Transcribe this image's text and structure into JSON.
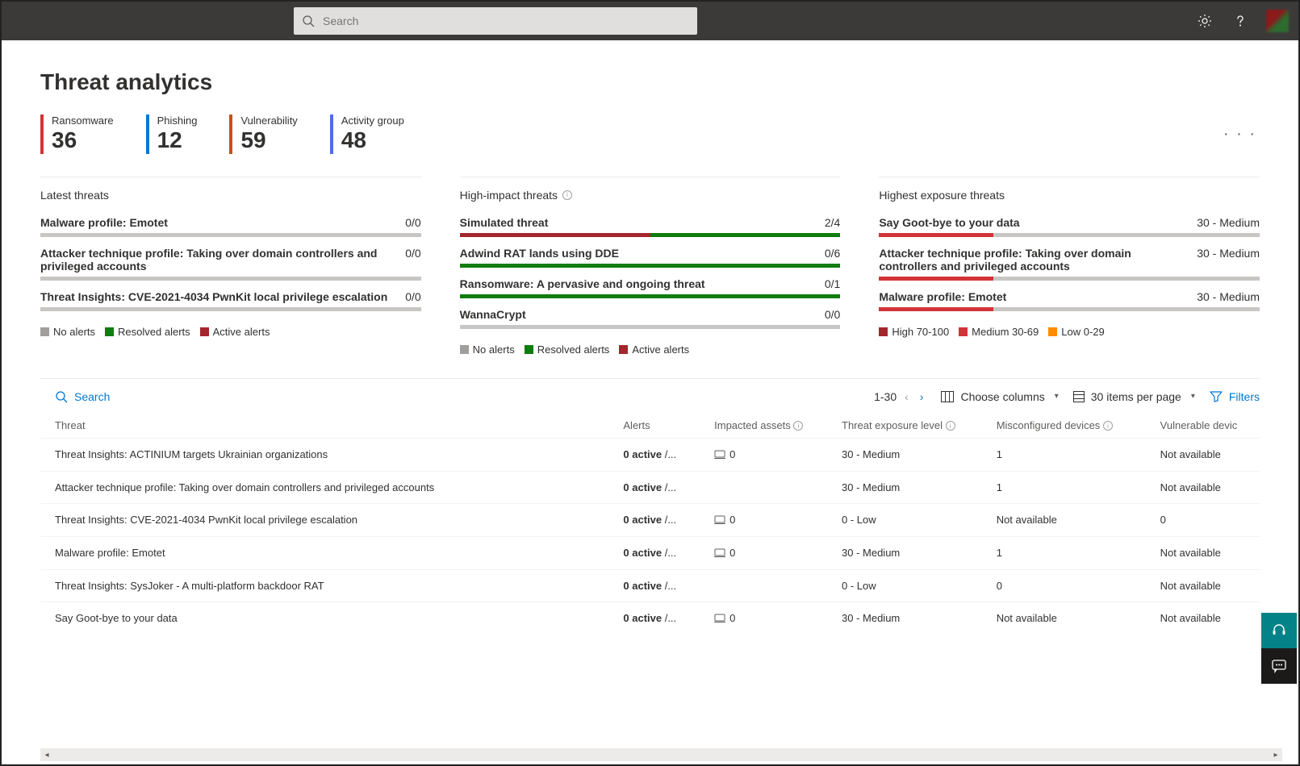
{
  "header": {
    "search_placeholder": "Search"
  },
  "page": {
    "title": "Threat analytics"
  },
  "kpis": [
    {
      "label": "Ransomware",
      "value": "36",
      "color": "#d13438"
    },
    {
      "label": "Phishing",
      "value": "12",
      "color": "#0078d4"
    },
    {
      "label": "Vulnerability",
      "value": "59",
      "color": "#ca5010"
    },
    {
      "label": "Activity group",
      "value": "48",
      "color": "#4f6bed"
    }
  ],
  "panels": {
    "latest": {
      "title": "Latest threats",
      "items": [
        {
          "name": "Malware profile: Emotet",
          "value": "0/0",
          "segments": []
        },
        {
          "name": "Attacker technique profile: Taking over domain controllers and privileged accounts",
          "value": "0/0",
          "segments": []
        },
        {
          "name": "Threat Insights: CVE-2021-4034 PwnKit local privilege escalation",
          "value": "0/0",
          "segments": []
        }
      ],
      "legend": [
        {
          "label": "No alerts",
          "color": "#a19f9d"
        },
        {
          "label": "Resolved alerts",
          "color": "#107c10"
        },
        {
          "label": "Active alerts",
          "color": "#a4262c"
        }
      ]
    },
    "high_impact": {
      "title": "High-impact threats",
      "items": [
        {
          "name": "Simulated threat",
          "value": "2/4",
          "segments": [
            {
              "color": "#a4262c",
              "pct": 50
            },
            {
              "color": "#107c10",
              "pct": 50
            }
          ]
        },
        {
          "name": "Adwind RAT lands using DDE",
          "value": "0/6",
          "segments": [
            {
              "color": "#107c10",
              "pct": 100
            }
          ]
        },
        {
          "name": "Ransomware: A pervasive and ongoing threat",
          "value": "0/1",
          "segments": [
            {
              "color": "#107c10",
              "pct": 100
            }
          ]
        },
        {
          "name": "WannaCrypt",
          "value": "0/0",
          "segments": []
        }
      ],
      "legend": [
        {
          "label": "No alerts",
          "color": "#a19f9d"
        },
        {
          "label": "Resolved alerts",
          "color": "#107c10"
        },
        {
          "label": "Active alerts",
          "color": "#a4262c"
        }
      ]
    },
    "exposure": {
      "title": "Highest exposure threats",
      "items": [
        {
          "name": "Say Goot-bye to your data",
          "value": "30 - Medium",
          "segments": [
            {
              "color": "#d13438",
              "pct": 30
            }
          ]
        },
        {
          "name": "Attacker technique profile: Taking over domain controllers and privileged accounts",
          "value": "30 - Medium",
          "segments": [
            {
              "color": "#d13438",
              "pct": 30
            }
          ]
        },
        {
          "name": "Malware profile: Emotet",
          "value": "30 - Medium",
          "segments": [
            {
              "color": "#d13438",
              "pct": 30
            }
          ]
        }
      ],
      "legend": [
        {
          "label": "High 70-100",
          "color": "#a4262c"
        },
        {
          "label": "Medium 30-69",
          "color": "#d13438"
        },
        {
          "label": "Low 0-29",
          "color": "#ff8c00"
        }
      ]
    }
  },
  "table": {
    "search_label": "Search",
    "range": "1-30",
    "choose_columns": "Choose columns",
    "items_per_page": "30 items per page",
    "filters": "Filters",
    "columns": [
      "Threat",
      "Alerts",
      "Impacted assets",
      "Threat exposure level",
      "Misconfigured devices",
      "Vulnerable devic"
    ],
    "rows": [
      {
        "threat": "Threat Insights: ACTINIUM targets Ukrainian organizations",
        "alerts_active": "0 active",
        "alerts_suffix": " /...",
        "assets": "0",
        "exposure": "30 - Medium",
        "misconf": "1",
        "vuln": "Not available"
      },
      {
        "threat": "Attacker technique profile: Taking over domain controllers and privileged accounts",
        "alerts_active": "0 active",
        "alerts_suffix": " /...",
        "assets": "",
        "exposure": "30 - Medium",
        "misconf": "1",
        "vuln": "Not available"
      },
      {
        "threat": "Threat Insights: CVE-2021-4034 PwnKit local privilege escalation",
        "alerts_active": "0 active",
        "alerts_suffix": " /...",
        "assets": "0",
        "exposure": "0 - Low",
        "misconf": "Not available",
        "vuln": "0"
      },
      {
        "threat": "Malware profile: Emotet",
        "alerts_active": "0 active",
        "alerts_suffix": " /...",
        "assets": "0",
        "exposure": "30 - Medium",
        "misconf": "1",
        "vuln": "Not available"
      },
      {
        "threat": "Threat Insights: SysJoker - A multi-platform backdoor RAT",
        "alerts_active": "0 active",
        "alerts_suffix": " /...",
        "assets": "",
        "exposure": "0 - Low",
        "misconf": "0",
        "vuln": "Not available"
      },
      {
        "threat": "Say Goot-bye to your data",
        "alerts_active": "0 active",
        "alerts_suffix": " /...",
        "assets": "0",
        "exposure": "30 - Medium",
        "misconf": "Not available",
        "vuln": "Not available"
      }
    ]
  }
}
